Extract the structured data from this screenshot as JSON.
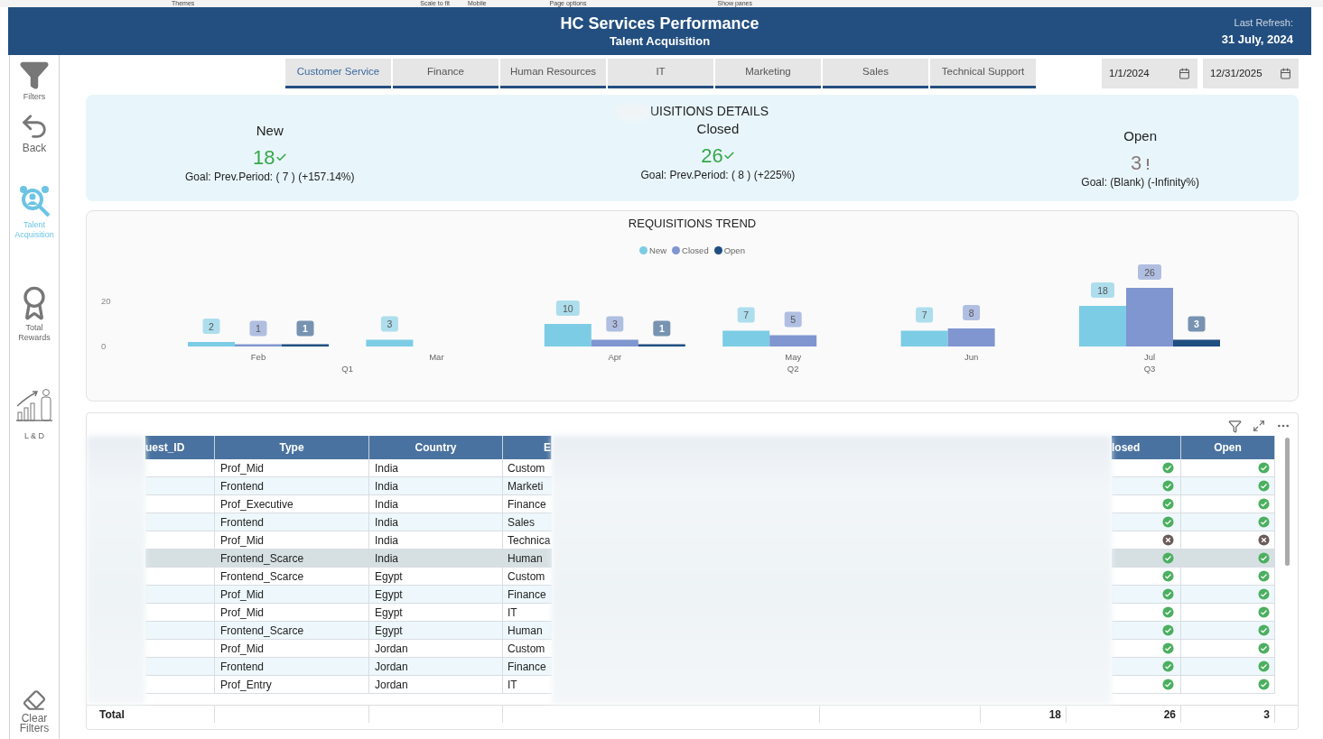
{
  "ribbon": [
    "Themes",
    "Scale to fit",
    "Mobile",
    "Page options",
    "Show panes"
  ],
  "header": {
    "title": "HC Services Performance",
    "subtitle": "Talent Acquisition",
    "refresh_label": "Last Refresh:",
    "refresh_date": "31 July, 2024"
  },
  "sidebar": [
    {
      "kind": "filter",
      "label": "Filters",
      "selected": false
    },
    {
      "kind": "back",
      "label": "Back",
      "selected": false
    },
    {
      "kind": "talent",
      "label": "Talent Acquisition",
      "selected": true
    },
    {
      "kind": "rewards",
      "label": "Total Rewards",
      "selected": false
    },
    {
      "kind": "growth",
      "label": "L & D",
      "selected": false
    },
    {
      "kind": "eraser",
      "label": "Clear Filters",
      "selected": false
    }
  ],
  "tabs": [
    {
      "label": "Customer Service",
      "selected": true
    },
    {
      "label": "Finance",
      "selected": false
    },
    {
      "label": "Human Resources",
      "selected": false
    },
    {
      "label": "IT",
      "selected": false
    },
    {
      "label": "Marketing",
      "selected": false
    },
    {
      "label": "Sales",
      "selected": false
    },
    {
      "label": "Technical Support",
      "selected": false
    }
  ],
  "date_range": [
    "1/1/2024",
    "12/31/2025"
  ],
  "kpis": {
    "title": "UISITIONS DETAILS",
    "items": [
      {
        "label": "New",
        "value": "18",
        "met": true,
        "goal": "Goal: Prev.Period: ( 7 ) (+157.14%)"
      },
      {
        "label": "Closed",
        "value": "26",
        "met": true,
        "goal": "Goal: Prev.Period: ( 8 ) (+225%)"
      },
      {
        "label": "Open",
        "value": "3",
        "met": false,
        "goal": "Goal: (Blank) (-Infinity%)"
      }
    ]
  },
  "trend": {
    "chart_data": {
      "type": "bar",
      "title": "REQUISITIONS TREND",
      "categories": [
        "Feb",
        "Mar",
        "Apr",
        "May",
        "Jun",
        "Jul"
      ],
      "series": [
        {
          "name": "New",
          "color": "#7ccce5",
          "values": [
            2,
            3,
            10,
            7,
            7,
            18
          ]
        },
        {
          "name": "Closed",
          "color": "#7f96d0",
          "values": [
            1,
            null,
            3,
            5,
            8,
            26
          ]
        },
        {
          "name": "Open",
          "color": "#1f4e80",
          "values": [
            1,
            null,
            1,
            null,
            null,
            3
          ]
        }
      ],
      "yticks": [
        0,
        20
      ],
      "ylim": [
        0,
        30
      ],
      "data_labels": true,
      "legend": "top"
    },
    "quarters": [
      "Q1",
      "Q2",
      "Q3"
    ]
  },
  "table": {
    "columns": [
      "uest_ID",
      "Type",
      "Country",
      "E",
      "losed",
      "Open"
    ],
    "rows": [
      {
        "type": "Prof_Mid",
        "country": "India",
        "dept": "Custom",
        "closed_ok": true,
        "open_ok": true,
        "selected": false
      },
      {
        "type": "Frontend",
        "country": "India",
        "dept": "Marketi",
        "closed_ok": true,
        "open_ok": true,
        "selected": false
      },
      {
        "type": "Prof_Executive",
        "country": "India",
        "dept": "Finance",
        "closed_ok": true,
        "open_ok": true,
        "selected": false
      },
      {
        "type": "Frontend",
        "country": "India",
        "dept": "Sales",
        "closed_ok": true,
        "open_ok": true,
        "selected": false
      },
      {
        "type": "Prof_Mid",
        "country": "India",
        "dept": "Technica",
        "closed_ok": false,
        "open_ok": false,
        "selected": false
      },
      {
        "type": "Frontend_Scarce",
        "country": "India",
        "dept": "Human",
        "closed_ok": true,
        "open_ok": true,
        "selected": true
      },
      {
        "type": "Frontend_Scarce",
        "country": "Egypt",
        "dept": "Custom",
        "closed_ok": true,
        "open_ok": true,
        "selected": false
      },
      {
        "type": "Prof_Mid",
        "country": "Egypt",
        "dept": "Finance",
        "closed_ok": true,
        "open_ok": true,
        "selected": false
      },
      {
        "type": "Prof_Mid",
        "country": "Egypt",
        "dept": "IT",
        "closed_ok": true,
        "open_ok": true,
        "selected": false
      },
      {
        "type": "Frontend_Scarce",
        "country": "Egypt",
        "dept": "Human",
        "closed_ok": true,
        "open_ok": true,
        "selected": false
      },
      {
        "type": "Prof_Mid",
        "country": "Jordan",
        "dept": "Custom",
        "closed_ok": true,
        "open_ok": true,
        "selected": false
      },
      {
        "type": "Frontend",
        "country": "Jordan",
        "dept": "Finance",
        "closed_ok": true,
        "open_ok": true,
        "selected": false
      },
      {
        "type": "Prof_Entry",
        "country": "Jordan",
        "dept": "IT",
        "closed_ok": true,
        "open_ok": true,
        "selected": false
      }
    ],
    "total": {
      "label": "Total",
      "values": [
        "18",
        "26",
        "3"
      ]
    }
  }
}
